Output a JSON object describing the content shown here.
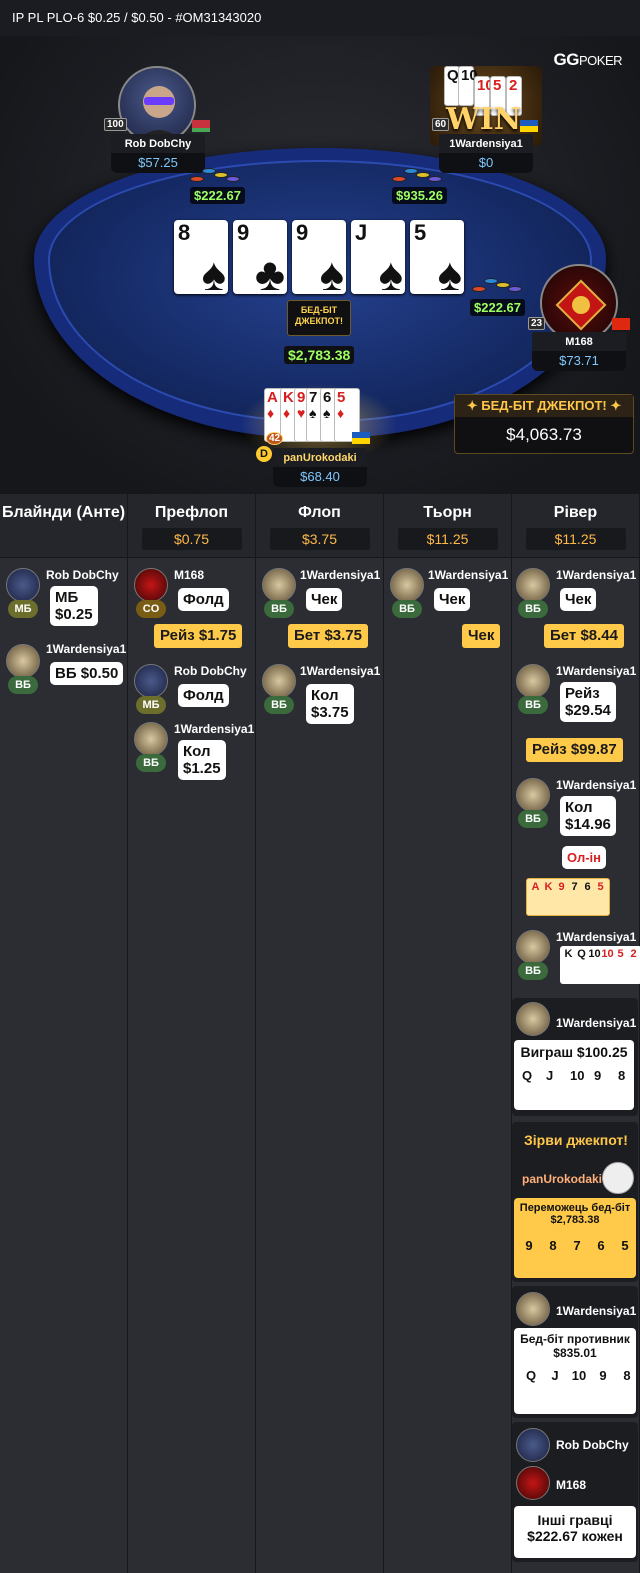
{
  "header": {
    "title": "IP PL PLO-6 $0.25 / $0.50  - #OM31343020"
  },
  "logo": {
    "brand": "GG",
    "text": "POKER"
  },
  "seats": [
    {
      "name": "Rob DobChy",
      "stack": "$57.25",
      "level": "100",
      "bet": "$222.67"
    },
    {
      "name": "1Wardensiya1",
      "stack": "$0",
      "level": "60",
      "bet": "$935.26",
      "win_label": "WIN",
      "cards": [
        "Q",
        "10",
        "K",
        "10",
        "5",
        "2"
      ]
    },
    {
      "name": "M168",
      "stack": "$73.71",
      "level": "23",
      "bet": "$222.67"
    },
    {
      "name": "panUrokodaki",
      "stack": "$68.40",
      "level": "42",
      "dealer": "D",
      "cards": [
        "A",
        "K",
        "9",
        "7",
        "6",
        "5"
      ]
    }
  ],
  "board": [
    {
      "rank": "8",
      "suit": "♠"
    },
    {
      "rank": "9",
      "suit": "♣"
    },
    {
      "rank": "9",
      "suit": "♠"
    },
    {
      "rank": "J",
      "suit": "♠"
    },
    {
      "rank": "5",
      "suit": "♠"
    }
  ],
  "table_jackpot": {
    "label": "БЕД-БІТ ДЖЕКПОТ!",
    "pot": "$2,783.38"
  },
  "big_jackpot": {
    "label": "✦ БЕД-БІТ ДЖЕКПОТ! ✦",
    "value": "$4,063.73"
  },
  "columns": [
    {
      "name": "Блайнди (Анте)",
      "pot": ""
    },
    {
      "name": "Префлоп",
      "pot": "$0.75"
    },
    {
      "name": "Флоп",
      "pot": "$3.75"
    },
    {
      "name": "Тьорн",
      "pot": "$11.25"
    },
    {
      "name": "Рівер",
      "pot": "$11.25"
    }
  ],
  "blinds": [
    {
      "player": "Rob DobChy",
      "pos": "МБ",
      "action_line1": "МБ",
      "action_line2": "$0.25"
    },
    {
      "player": "1Wardensiya1",
      "pos": "ВБ",
      "action_line1": "ВБ $0.50"
    }
  ],
  "preflop": [
    {
      "player": "M168",
      "pos": "CO",
      "action": "Фолд"
    },
    {
      "raise": "Рейз $1.75"
    },
    {
      "player": "Rob DobChy",
      "pos": "МБ",
      "action": "Фолд"
    },
    {
      "player": "1Wardensiya1",
      "pos": "ВБ",
      "action_line1": "Кол",
      "action_line2": "$1.25"
    }
  ],
  "flop": [
    {
      "player": "1Wardensiya1",
      "pos": "ВБ",
      "action": "Чек"
    },
    {
      "raise": "Бет $3.75"
    },
    {
      "player": "1Wardensiya1",
      "pos": "ВБ",
      "action_line1": "Кол",
      "action_line2": "$3.75"
    }
  ],
  "turn": [
    {
      "player": "1Wardensiya1",
      "pos": "ВБ",
      "action": "Чек"
    },
    {
      "raise": "Чек"
    }
  ],
  "river": [
    {
      "player": "1Wardensiya1",
      "pos": "ВБ",
      "action": "Чек"
    },
    {
      "raise": "Бет $8.44"
    },
    {
      "player": "1Wardensiya1",
      "pos": "ВБ",
      "action_line1": "Рейз",
      "action_line2": "$29.54"
    },
    {
      "raise": "Рейз $99.87"
    },
    {
      "player": "1Wardensiya1",
      "pos": "ВБ",
      "action_line1": "Кол",
      "action_line2": "$14.96"
    },
    {
      "allin": "Ол-ін"
    },
    {
      "player": "1Wardensiya1",
      "pos": "ВБ"
    }
  ],
  "hero_show": [
    "A",
    "K",
    "9",
    "7",
    "6",
    "5"
  ],
  "villain_show": [
    "K",
    "Q",
    "10",
    "10",
    "5",
    "2"
  ],
  "results": {
    "winner": "1Wardensiya1",
    "win_text": "Виграш $100.25",
    "win_cards": [
      "Q",
      "J",
      "10",
      "9",
      "8"
    ],
    "jackpot_title": "Зірви джекпот!",
    "jp_player": "panUrokodaki",
    "bb_win_line1": "Переможець бед-біт",
    "bb_win_line2": "$2,783.38",
    "bb_cards": [
      "9",
      "8",
      "7",
      "6",
      "5"
    ],
    "opp_player": "1Wardensiya1",
    "opp_line1": "Бед-біт противник",
    "opp_line2": "$835.01",
    "opp_cards": [
      "Q",
      "J",
      "10",
      "9",
      "8"
    ],
    "others": [
      "Rob DobChy",
      "M168"
    ],
    "others_line1": "Інші гравці",
    "others_line2": "$222.67 кожен"
  }
}
